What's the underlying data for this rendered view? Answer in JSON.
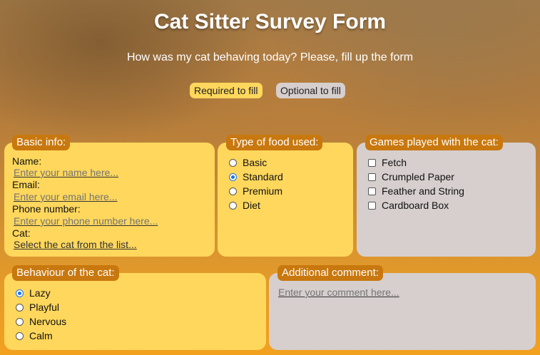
{
  "header": {
    "title": "Cat Sitter Survey Form",
    "subtitle": "How was my cat behaving today? Please, fill up the form"
  },
  "legend_chips": {
    "required": "Required to fill",
    "optional": "Optional to fill"
  },
  "basic_info": {
    "legend": "Basic info:",
    "name_label": "Name:",
    "name_placeholder": "Enter your name here...",
    "email_label": "Email:",
    "email_placeholder": "Enter your email here...",
    "phone_label": "Phone number:",
    "phone_placeholder": "Enter your phone number here...",
    "cat_label": "Cat:",
    "cat_select": "Select the cat from the list..."
  },
  "food": {
    "legend": "Type of food used:",
    "options": [
      {
        "label": "Basic",
        "checked": false
      },
      {
        "label": "Standard",
        "checked": true
      },
      {
        "label": "Premium",
        "checked": false
      },
      {
        "label": "Diet",
        "checked": false
      }
    ]
  },
  "games": {
    "legend": "Games played with the cat:",
    "options": [
      {
        "label": "Fetch",
        "checked": false
      },
      {
        "label": "Crumpled Paper",
        "checked": false
      },
      {
        "label": "Feather and String",
        "checked": false
      },
      {
        "label": "Cardboard Box",
        "checked": false
      }
    ]
  },
  "behaviour": {
    "legend": "Behaviour of the cat:",
    "options": [
      {
        "label": "Lazy",
        "checked": true
      },
      {
        "label": "Playful",
        "checked": false
      },
      {
        "label": "Nervous",
        "checked": false
      },
      {
        "label": "Calm",
        "checked": false
      }
    ]
  },
  "comment": {
    "legend": "Additional comment:",
    "placeholder": "Enter your comment here..."
  },
  "colors": {
    "required": "#ffd75c",
    "optional": "#d6cfce",
    "legend_bg": "#c8780e"
  }
}
